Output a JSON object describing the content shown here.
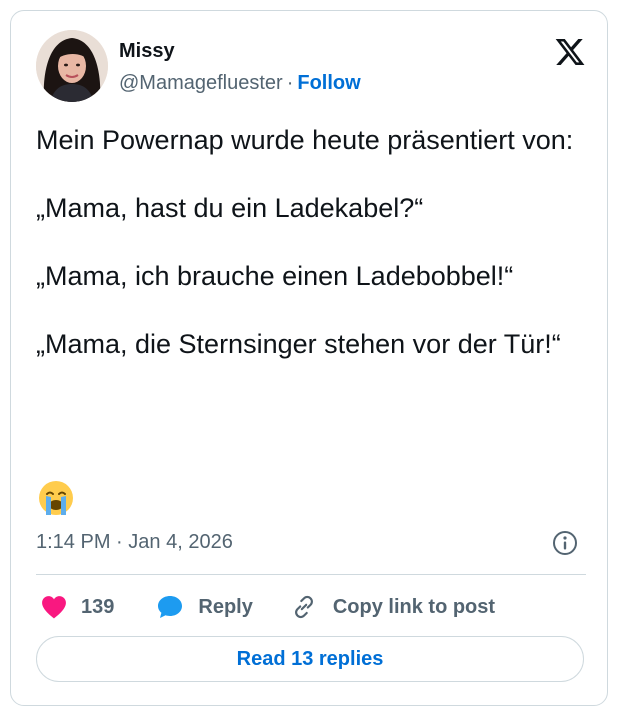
{
  "author": {
    "name": "Missy",
    "handle": "@Mamagefluester",
    "separator": "·",
    "follow_label": "Follow"
  },
  "tweet": {
    "lines": [
      "Mein Powernap wurde heute präsentiert von:",
      "„Mama, hast du ein Ladekabel?“",
      "„Mama, ich brauche einen Ladebobbel!“",
      "„Mama, die Sternsinger stehen vor der Tür!“"
    ],
    "emoji": "loudly-crying-face",
    "time": "1:14 PM",
    "date_separator": "·",
    "date": "Jan 4, 2026"
  },
  "actions": {
    "like_count": "139",
    "reply_label": "Reply",
    "copy_link_label": "Copy link to post"
  },
  "read_replies_label": "Read 13 replies",
  "colors": {
    "text": "#0f1419",
    "secondary": "#536471",
    "link": "#006fd6",
    "like": "#f91880",
    "reply": "#1d9bf0",
    "border": "#cfd9de"
  }
}
